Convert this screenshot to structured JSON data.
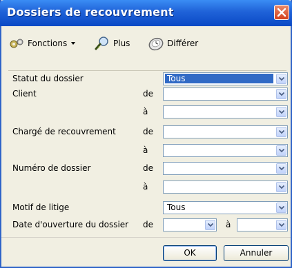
{
  "window": {
    "title": "Dossiers de recouvrement"
  },
  "toolbar": {
    "functions_label": "Fonctions",
    "more_label": "Plus",
    "defer_label": "Différer"
  },
  "form": {
    "status": {
      "label": "Statut du dossier",
      "value": "Tous"
    },
    "client": {
      "label": "Client",
      "from": "de",
      "to": "à",
      "from_value": "",
      "to_value": ""
    },
    "collector": {
      "label": "Chargé de recouvrement",
      "from": "de",
      "to": "à",
      "from_value": "",
      "to_value": ""
    },
    "file_number": {
      "label": "Numéro de dossier",
      "from": "de",
      "to": "à",
      "from_value": "",
      "to_value": ""
    },
    "dispute_reason": {
      "label": "Motif de litige",
      "value": "Tous"
    },
    "open_date": {
      "label": "Date d'ouverture du dossier",
      "from": "de",
      "to": "à",
      "from_value": "",
      "to_value": ""
    }
  },
  "buttons": {
    "ok": "OK",
    "cancel": "Annuler"
  }
}
